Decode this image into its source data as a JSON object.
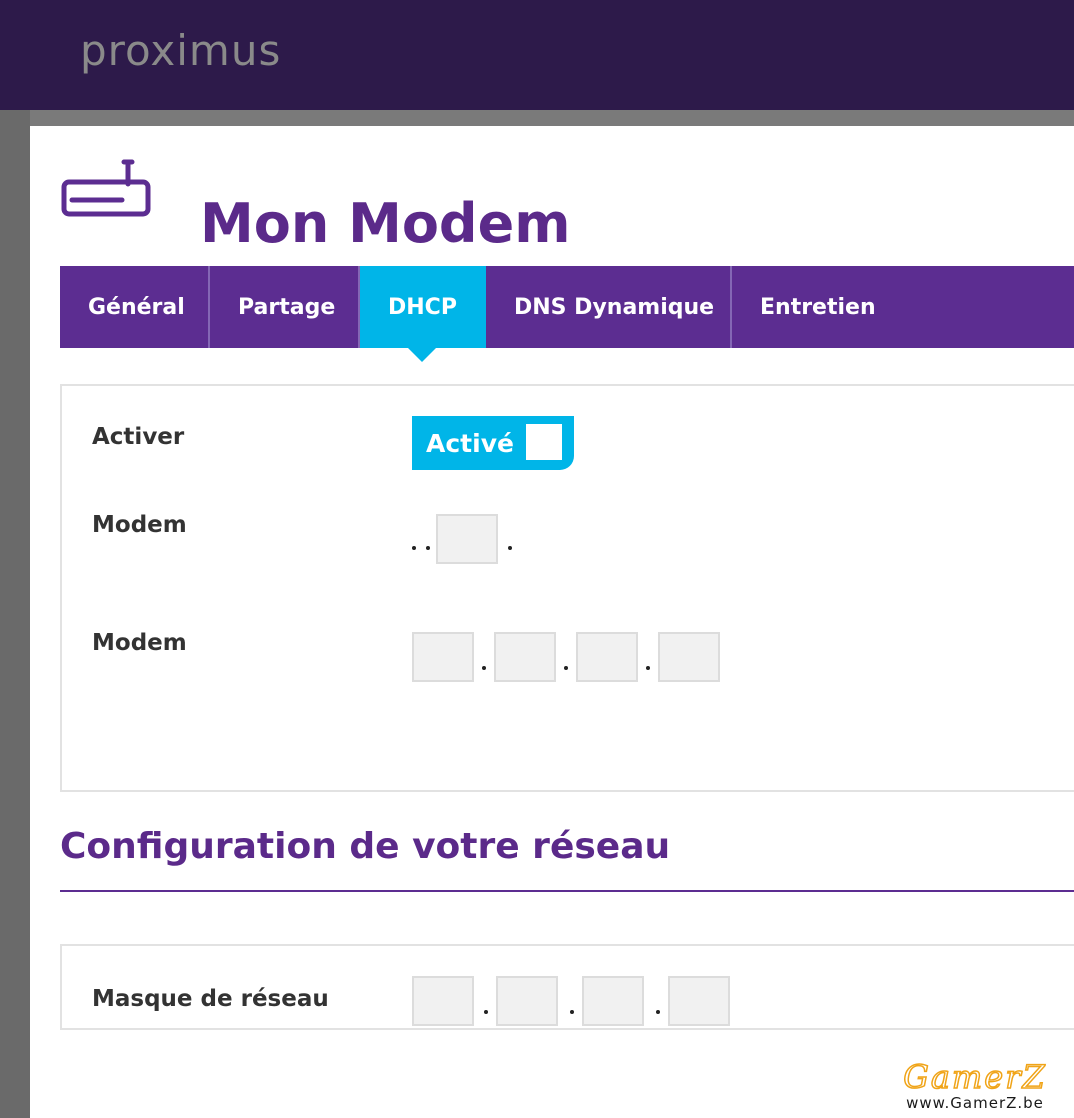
{
  "brand": {
    "logo_text": "proximus"
  },
  "page": {
    "title": "Mon Modem"
  },
  "tabs": [
    {
      "label": "Général",
      "active": false
    },
    {
      "label": "Partage",
      "active": false
    },
    {
      "label": "DHCP",
      "active": true
    },
    {
      "label": "DNS Dynamique",
      "active": false
    },
    {
      "label": "Entretien",
      "active": false
    }
  ],
  "dhcp": {
    "enable_label": "Activer",
    "toggle_label": "Activé",
    "toggle_on": true,
    "modem_ip_label": "Modem",
    "modem_ip_value": [
      "",
      "",
      "",
      ""
    ],
    "modem_mask_label": "Modem",
    "modem_mask_value": [
      "",
      "",
      "",
      ""
    ]
  },
  "network_config": {
    "title": "Configuration de votre réseau",
    "netmask_label": "Masque de réseau",
    "netmask_value": [
      "",
      "",
      "",
      ""
    ]
  },
  "watermark": {
    "brand": "GamerZ",
    "url": "www.GamerZ.be"
  },
  "colors": {
    "header_bg": "#2d1a4a",
    "brand_purple": "#5c2d91",
    "active_tab": "#00b5e8"
  }
}
